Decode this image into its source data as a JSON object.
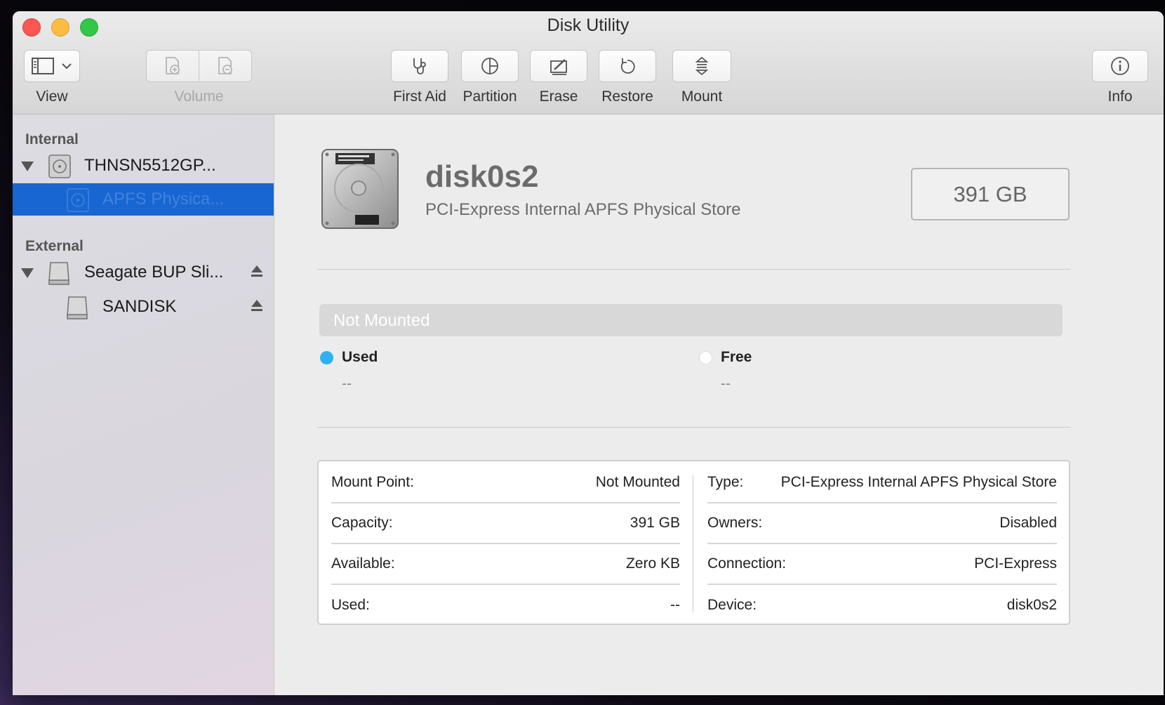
{
  "window": {
    "title": "Disk Utility"
  },
  "toolbar": {
    "view_label": "View",
    "volume_label": "Volume",
    "first_aid_label": "First Aid",
    "partition_label": "Partition",
    "erase_label": "Erase",
    "restore_label": "Restore",
    "mount_label": "Mount",
    "info_label": "Info"
  },
  "sidebar": {
    "internal_header": "Internal",
    "external_header": "External",
    "internal_items": [
      {
        "label": "THNSN5512GP...",
        "icon": "internal-hdd-icon"
      },
      {
        "label": "APFS Physica...",
        "icon": "internal-hdd-icon",
        "selected": true
      }
    ],
    "external_items": [
      {
        "label": "Seagate BUP Sli...",
        "icon": "external-disk-icon",
        "eject": true
      },
      {
        "label": "SANDISK",
        "icon": "external-disk-icon",
        "eject": true
      }
    ]
  },
  "detail": {
    "name": "disk0s2",
    "description": "PCI-Express Internal APFS Physical Store",
    "size": "391 GB",
    "mount_status": "Not Mounted",
    "used_label": "Used",
    "used_value": "--",
    "free_label": "Free",
    "free_value": "--",
    "used_color": "#2cb2f4",
    "free_color": "#ffffff"
  },
  "info": {
    "left": [
      {
        "label": "Mount Point:",
        "value": "Not Mounted"
      },
      {
        "label": "Capacity:",
        "value": "391 GB"
      },
      {
        "label": "Available:",
        "value": "Zero KB"
      },
      {
        "label": "Used:",
        "value": "--"
      }
    ],
    "right": [
      {
        "label": "Type:",
        "value": "PCI-Express Internal APFS Physical Store"
      },
      {
        "label": "Owners:",
        "value": "Disabled"
      },
      {
        "label": "Connection:",
        "value": "PCI-Express"
      },
      {
        "label": "Device:",
        "value": "disk0s2"
      }
    ]
  }
}
